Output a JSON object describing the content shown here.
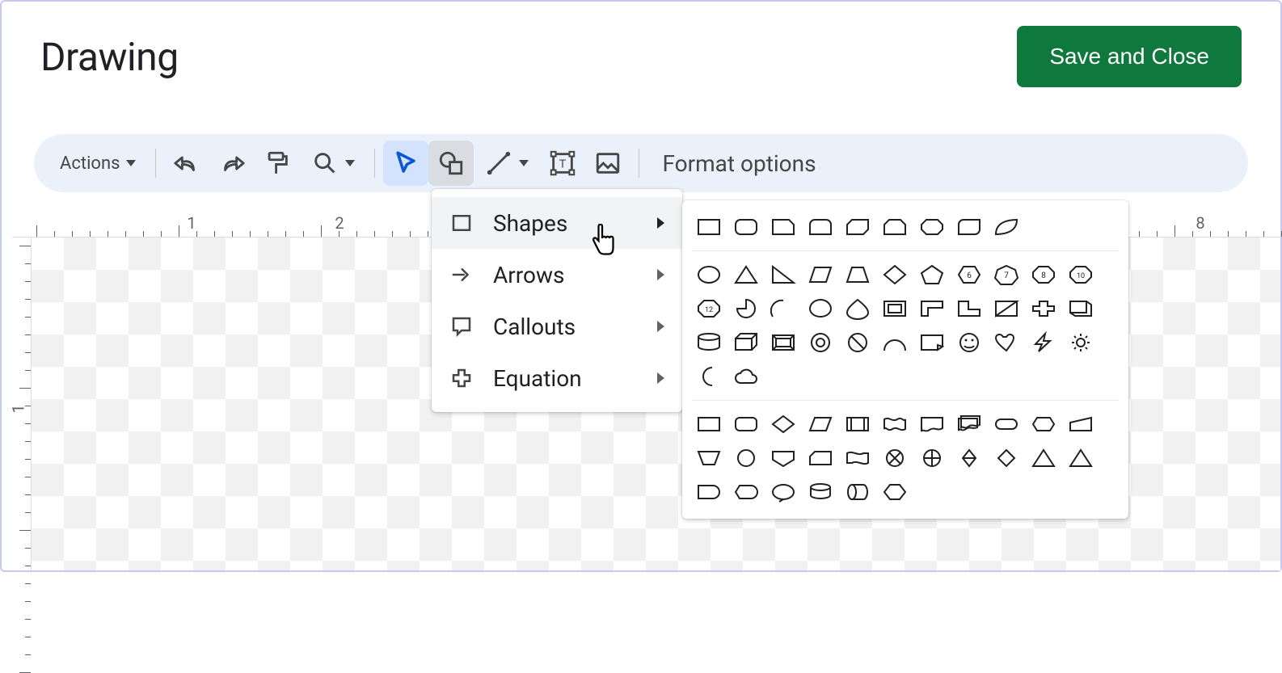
{
  "header": {
    "title": "Drawing",
    "save_label": "Save and Close"
  },
  "toolbar": {
    "actions_label": "Actions",
    "format_options_label": "Format options",
    "buttons": [
      "undo",
      "redo",
      "paint-format",
      "zoom",
      "select",
      "shape",
      "line",
      "text-box",
      "image"
    ]
  },
  "ruler": {
    "h_numbers": [
      "1",
      "2",
      "8"
    ],
    "v_numbers": [
      "1"
    ]
  },
  "shape_menu": {
    "items": [
      {
        "label": "Shapes",
        "icon": "rect-icon",
        "active": true
      },
      {
        "label": "Arrows",
        "icon": "arrow-icon",
        "active": false
      },
      {
        "label": "Callouts",
        "icon": "callout-icon",
        "active": false
      },
      {
        "label": "Equation",
        "icon": "plus-icon",
        "active": false
      }
    ]
  },
  "shapes_panel": {
    "group1": [
      "rect",
      "round-rect",
      "snip-corner",
      "round-top",
      "snip-diag",
      "snip-top",
      "octa-round",
      "round-diag",
      "leaf"
    ],
    "group2": [
      "circle",
      "triangle",
      "right-tri",
      "parallelogram",
      "trapezoid",
      "diamond",
      "pentagon",
      "hex-6",
      "hept-7",
      "oct-8",
      "deca-10",
      "dodec-12",
      "pie",
      "arc",
      "teardrop",
      "drop",
      "frame",
      "corner",
      "l-shape",
      "slash-rect",
      "cross",
      "cube-hollow",
      "cylinder",
      "cube",
      "bevel",
      "donut",
      "no-symbol",
      "arc-half",
      "folded",
      "smiley",
      "heart",
      "lightning",
      "sun",
      "moon",
      "cloud"
    ],
    "group3": [
      "flow-rect",
      "flow-round",
      "flow-decision",
      "flow-data",
      "flow-predef",
      "flow-wave",
      "flow-doc",
      "flow-multidoc",
      "flow-terminator",
      "flow-prep",
      "flow-manual-input",
      "flow-trapdown",
      "flow-circle",
      "flow-offpage",
      "flow-card",
      "flow-tape",
      "flow-sum",
      "flow-or",
      "flow-sort",
      "flow-merge",
      "flow-extract",
      "flow-delay",
      "flow-storage",
      "flow-display",
      "flow-loop",
      "flow-db",
      "flow-disk",
      "flow-direct"
    ]
  }
}
